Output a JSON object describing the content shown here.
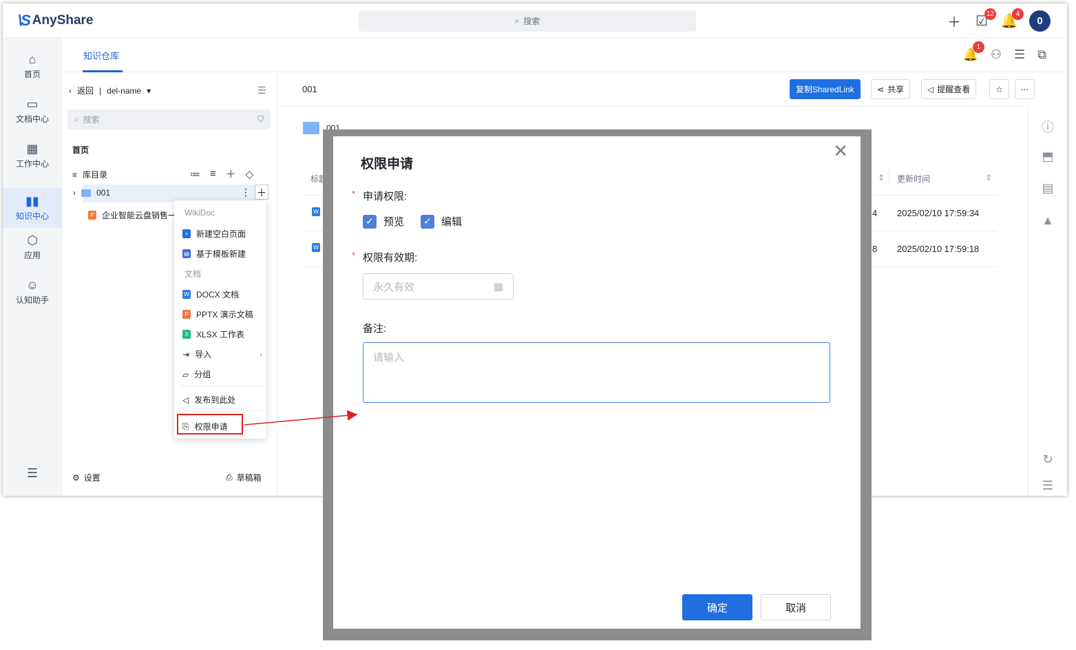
{
  "app": {
    "logo_mark": "\\S",
    "logo_text": "AnyShare"
  },
  "topbar": {
    "search_placeholder": "搜索",
    "tasks_badge": "12",
    "bell_badge": "4",
    "avatar": "0"
  },
  "subbar": {
    "tab": "知识仓库",
    "notify_badge": "1"
  },
  "nav": {
    "items": [
      {
        "label": "首页",
        "icon": "home-icon"
      },
      {
        "label": "文档中心",
        "icon": "folder-icon"
      },
      {
        "label": "工作中心",
        "icon": "grid-icon"
      },
      {
        "label": "知识中心",
        "icon": "book-icon"
      },
      {
        "label": "应用",
        "icon": "app-icon"
      },
      {
        "label": "认知助手",
        "icon": "robot-icon"
      }
    ]
  },
  "tree": {
    "back": "返回",
    "repo": "del-name",
    "search_placeholder": "搜索",
    "home": "首页",
    "catalog": "库目录",
    "folder": "001",
    "doc": "企业智能云盘销售一",
    "settings": "设置",
    "drafts": "草稿箱"
  },
  "menu": {
    "wikidoc_head": "WikiDoc",
    "new_blank": "新建空白页面",
    "from_template": "基于模板新建",
    "doc_head": "文档",
    "docx": "DOCX 文档",
    "pptx": "PPTX 演示文稿",
    "xlsx": "XLSX 工作表",
    "import": "导入",
    "group": "分组",
    "publish": "发布到此处",
    "permission": "权限申请"
  },
  "content": {
    "crumb": "001",
    "copy_link": "复制SharedLink",
    "share": "共享",
    "remind": "提醒查看",
    "folder_name": "001",
    "col_title": "标题",
    "col_updated": "更新时间",
    "rows": [
      {
        "size_tail": "4",
        "updated": "2025/02/10 17:59:34"
      },
      {
        "size_tail": "8",
        "updated": "2025/02/10 17:59:18"
      }
    ]
  },
  "modal": {
    "title": "权限申请",
    "perm_label": "申请权限:",
    "perm_preview": "预览",
    "perm_edit": "编辑",
    "validity_label": "权限有效期:",
    "validity_value": "永久有效",
    "note_label": "备注:",
    "note_placeholder": "请输入",
    "ok": "确定",
    "cancel": "取消"
  },
  "colors": {
    "accent": "#1f6fe0",
    "highlight": "#e02020",
    "badge": "#f03a3a"
  }
}
